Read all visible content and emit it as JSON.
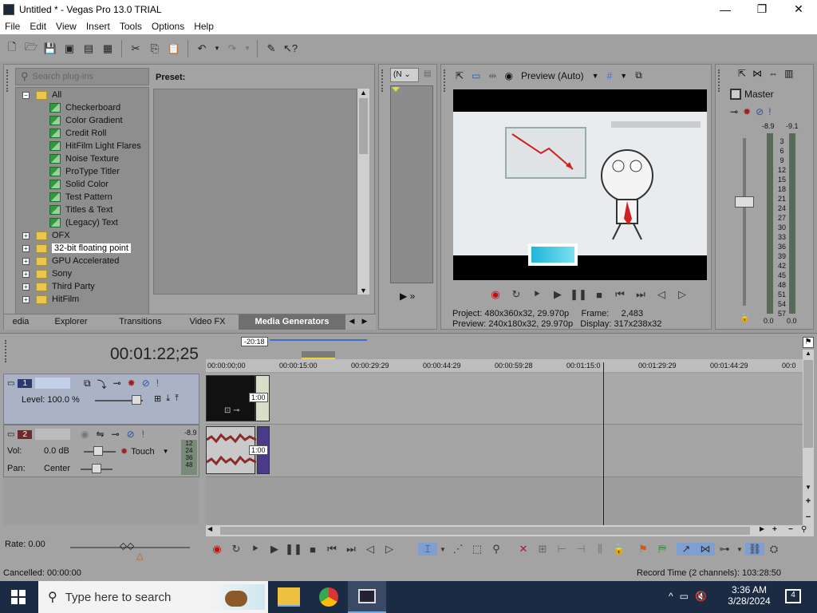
{
  "window": {
    "title": "Untitled * - Vegas Pro 13.0 TRIAL",
    "min": "—",
    "max": "❐",
    "close": "✕"
  },
  "menu": [
    "File",
    "Edit",
    "View",
    "Insert",
    "Tools",
    "Options",
    "Help"
  ],
  "plugins": {
    "search_placeholder": "Search plug-ins",
    "preset_label": "Preset:",
    "tree": {
      "all": "All",
      "items": [
        "Checkerboard",
        "Color Gradient",
        "Credit Roll",
        "HitFilm Light Flares",
        "Noise Texture",
        "ProType Titler",
        "Solid Color",
        "Test Pattern",
        "Titles & Text",
        "(Legacy) Text"
      ],
      "groups": [
        "OFX",
        "32-bit floating point",
        "GPU Accelerated",
        "Sony",
        "Third Party",
        "HitFilm"
      ]
    }
  },
  "tabs": [
    {
      "label": "edia"
    },
    {
      "label": "Explorer"
    },
    {
      "label": "Transitions"
    },
    {
      "label": "Video FX"
    },
    {
      "label": "Media Generators",
      "active": true
    }
  ],
  "trimmer": {
    "dropdown": "(N"
  },
  "preview": {
    "mode": "Preview (Auto)",
    "project_label": "Project:",
    "project_value": "480x360x32, 29.970p",
    "frame_label": "Frame:",
    "frame_value": "2,483",
    "preview_label": "Preview:",
    "preview_value": "240x180x32, 29.970p",
    "display_label": "Display:",
    "display_value": "317x238x32"
  },
  "master": {
    "title": "Master",
    "peak_l": "-8.9",
    "peak_r": "-9.1",
    "scale": [
      "3",
      "6",
      "9",
      "12",
      "15",
      "18",
      "21",
      "24",
      "27",
      "30",
      "33",
      "36",
      "39",
      "42",
      "45",
      "48",
      "51",
      "54",
      "57"
    ],
    "foot_l": "0.0",
    "foot_r": "0.0",
    "fader_level": 0.62
  },
  "timeline": {
    "timecode": "00:01:22;25",
    "offset": "-20:18",
    "ruler": [
      "00:00:00;00",
      "00:00:15:00",
      "00:00:29:29",
      "00:00:44:29",
      "00:00:59:28",
      "00:01:15:0",
      "00:01:29:29",
      "00:01:44:29",
      "00:0"
    ],
    "clip_label_1": "1:00",
    "clip_label_2": "1:00",
    "track1": {
      "num": "1",
      "level": "Level: 100.0 %"
    },
    "track2": {
      "num": "2",
      "vol_label": "Vol:",
      "vol_value": "0.0 dB",
      "pan_label": "Pan:",
      "pan_value": "Center",
      "touch": "Touch",
      "meter_peak": "-8.9",
      "meter": [
        "12",
        "24",
        "36",
        "48"
      ]
    }
  },
  "rate": "Rate: 0.00",
  "status": {
    "left": "Cancelled: 00:00:00",
    "right": "Record Time (2 channels): 103:28:50"
  },
  "taskbar": {
    "search": "Type here to search",
    "time": "3:36 AM",
    "date": "3/28/2024",
    "notif": "4"
  }
}
